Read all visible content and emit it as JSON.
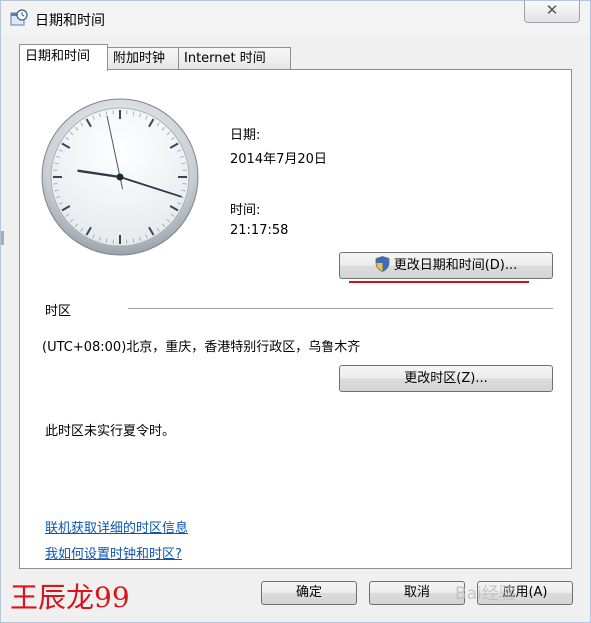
{
  "window": {
    "title": "日期和时间",
    "close_glyph": "✕"
  },
  "tabs": [
    {
      "label": "日期和时间",
      "active": true
    },
    {
      "label": "附加时钟",
      "active": false
    },
    {
      "label": "Internet 时间",
      "active": false
    }
  ],
  "clock": {
    "hour": 21,
    "minute": 17,
    "second": 58
  },
  "date_section": {
    "date_label": "日期:",
    "date_value": "2014年7月20日",
    "time_label": "时间:",
    "time_value": "21:17:58"
  },
  "change_datetime_button": {
    "label": "更改日期和时间(D)...",
    "icon": "uac-shield-icon"
  },
  "timezone": {
    "header": "时区",
    "value": "(UTC+08:00)北京，重庆，香港特别行政区，乌鲁木齐",
    "change_button": "更改时区(Z)...",
    "dst_note": "此时区未实行夏令时。"
  },
  "links": [
    "联机获取详细的时区信息",
    "我如何设置时钟和时区?"
  ],
  "footer": {
    "ok": "确定",
    "cancel": "取消",
    "apply": "应用(A)"
  },
  "watermark": "王辰龙99",
  "baidu_mark": "Bai经验",
  "colors": {
    "accent_red": "#c4161c",
    "link": "#0c55b0",
    "panel_border": "#8e8f8f"
  }
}
